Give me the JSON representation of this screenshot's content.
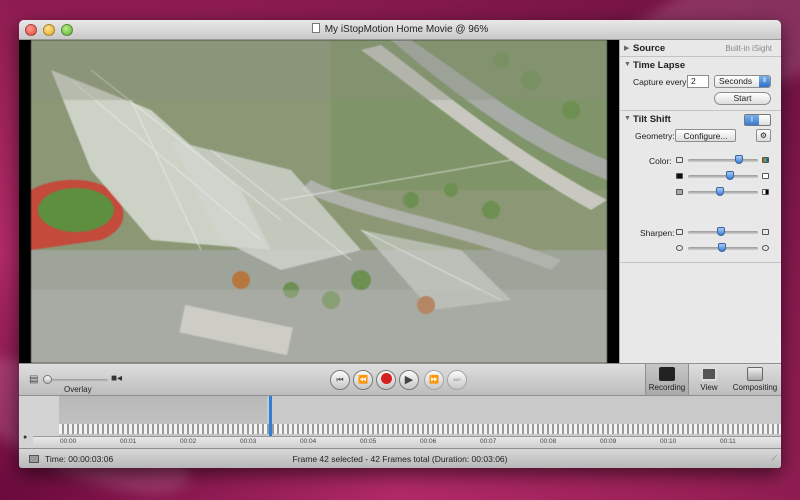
{
  "window": {
    "title": "My iStopMotion Home Movie @ 96%"
  },
  "inspector": {
    "source": {
      "label": "Source",
      "value": "Built-in iSight"
    },
    "time_lapse": {
      "label": "Time Lapse",
      "capture_label": "Capture every:",
      "capture_value": "2",
      "unit_selected": "Seconds",
      "start_label": "Start"
    },
    "tilt_shift": {
      "label": "Tilt Shift",
      "geometry_label": "Geometry:",
      "configure_label": "Configure...",
      "color_label": "Color:",
      "sharpen_label": "Sharpen:"
    }
  },
  "toolbar": {
    "overlay_label": "Overlay"
  },
  "modes": [
    {
      "label": "Recording",
      "icon": "clapper-icon"
    },
    {
      "label": "View",
      "icon": "portrait-icon"
    },
    {
      "label": "Compositing",
      "icon": "layers-icon"
    }
  ],
  "timeline": {
    "ticks": [
      "00:00",
      "00:01",
      "00:02",
      "00:03",
      "00:04",
      "00:05",
      "00:06",
      "00:07",
      "00:08",
      "00:09",
      "00:10",
      "00:11"
    ]
  },
  "status": {
    "time": "Time: 00:00:03:06",
    "frames": "Frame 42 selected - 42 Frames total (Duration: 00:03:06)"
  },
  "colors": {
    "accent": "#3b7fd6",
    "record": "#d81f1f",
    "playhead": "#2e7fd9"
  }
}
